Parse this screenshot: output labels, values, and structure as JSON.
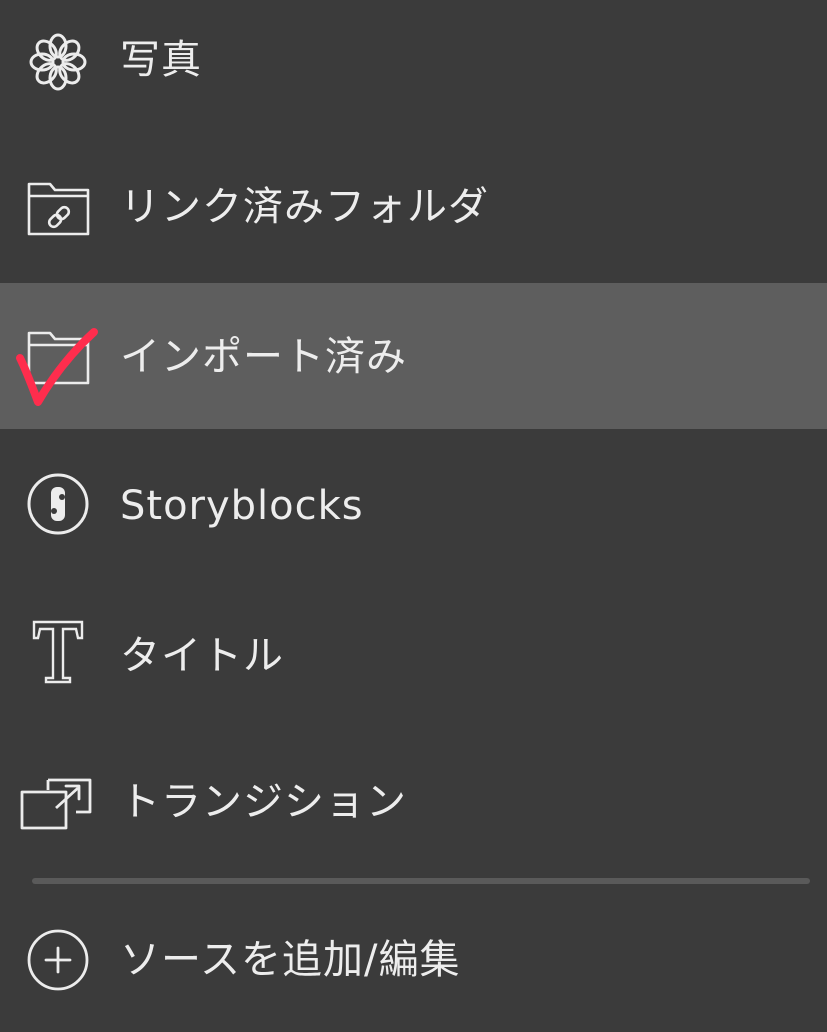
{
  "menu": {
    "items": [
      {
        "label": "写真",
        "icon": "photos-flower-icon",
        "selected": false
      },
      {
        "label": "リンク済みフォルダ",
        "icon": "linked-folder-icon",
        "selected": false
      },
      {
        "label": "インポート済み",
        "icon": "folder-icon",
        "selected": true
      },
      {
        "label": "Storyblocks",
        "icon": "storyblocks-icon",
        "selected": false
      },
      {
        "label": "タイトル",
        "icon": "title-t-icon",
        "selected": false
      },
      {
        "label": "トランジション",
        "icon": "transition-icon",
        "selected": false
      },
      {
        "label": "ソースを追加/編集",
        "icon": "add-circle-icon",
        "selected": false
      }
    ]
  },
  "colors": {
    "background": "#3b3b3b",
    "selected_background": "#5e5e5e",
    "text": "#ededed",
    "checkmark": "#ff2d4d"
  }
}
